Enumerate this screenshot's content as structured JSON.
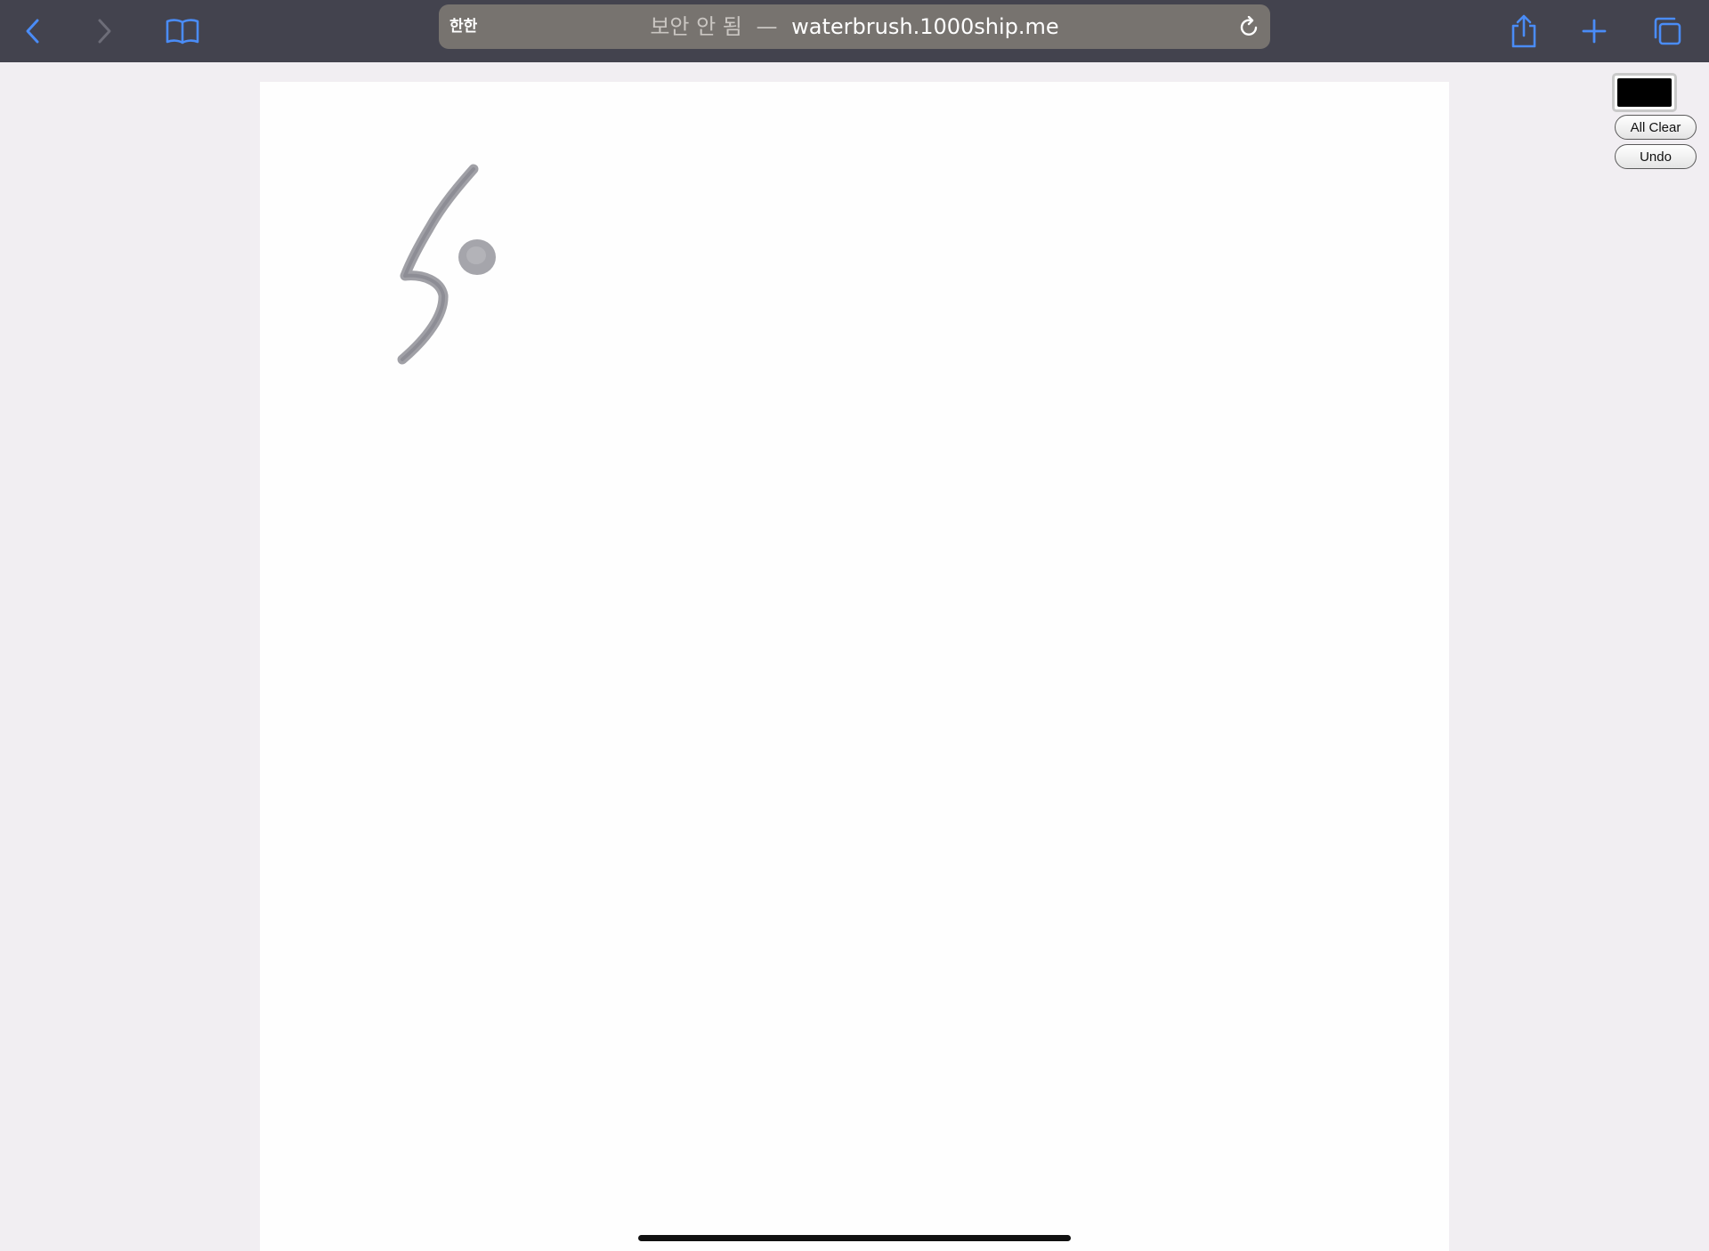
{
  "toolbar": {
    "reader_label": "한한",
    "url_insecure": "보안 안 됨",
    "url_separator": "—",
    "url_domain": "waterbrush.1000ship.me",
    "icons": {
      "back": "chevron-left-icon",
      "forward": "chevron-right-icon",
      "bookmarks": "book-icon",
      "reload": "reload-icon",
      "share": "share-icon",
      "new_tab": "plus-icon",
      "tabs": "tabs-icon"
    },
    "accent_color": "#4a8cf7"
  },
  "controls": {
    "color_value": "#000000",
    "all_clear_label": "All Clear",
    "undo_label": "Undo"
  }
}
